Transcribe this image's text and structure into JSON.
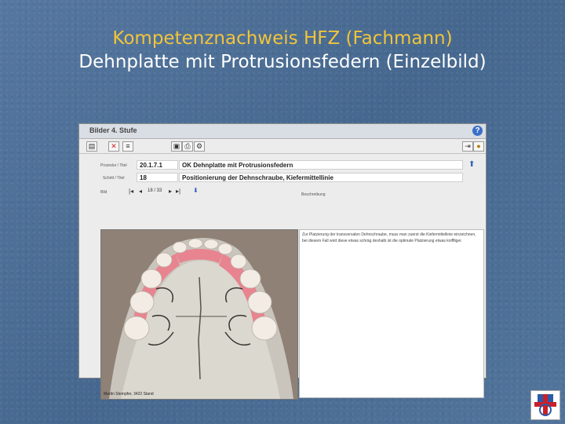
{
  "slide": {
    "title_line1": "Kompetenznachweis HFZ (Fachmann)",
    "title_line2": "Dehnplatte mit Protrusionsfedern (Einzelbild)"
  },
  "app": {
    "window_title": "Bilder  4. Stufe",
    "help_symbol": "?",
    "form": {
      "proc_label": "Prozedur / Titel",
      "proc_number": "20.1.7.1",
      "proc_title": "OK Dehnplatte mit Protrusionsfedern",
      "step_label": "Schritt / Titel",
      "step_number": "18",
      "step_title": "Positionierung der Dehnschraube, Kiefermittellinie",
      "image_label": "Bild",
      "nav_text": "18 / 33",
      "desc_label": "Beschreibung",
      "description": "Zur Platzierung der transversalen Dehnschraube, muss man zuerst die Kiefermittellinie einzeichnen, bei diesem Fall wird diese etwas schräg deshalb ist die optimale Platzierung etwas kniffliger.",
      "photo_credit": "Martin Stempfer, 3422 Stand"
    }
  },
  "colors": {
    "background": "#4d6f95",
    "title_accent": "#f2c43a",
    "title_white": "#ffffff"
  }
}
